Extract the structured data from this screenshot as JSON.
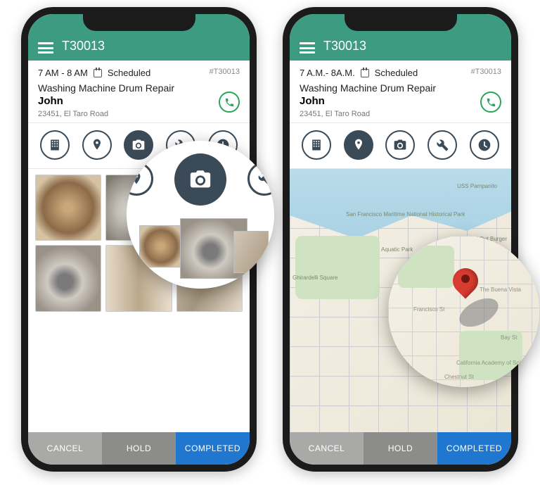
{
  "left": {
    "header": {
      "title": "T30013"
    },
    "ticket": {
      "time": "7 AM - 8 AM",
      "status": "Scheduled",
      "id": "#T30013",
      "title": "Washing Machine Drum Repair",
      "customer": "John",
      "address": "23451, El Taro Road"
    },
    "footer": {
      "cancel": "CANCEL",
      "hold": "HOLD",
      "completed": "COMPLETED"
    }
  },
  "right": {
    "header": {
      "title": "T30013"
    },
    "ticket": {
      "time": "7 A.M.- 8A.M.",
      "status": "Scheduled",
      "id": "#T30013",
      "title": "Washing Machine Drum Repair",
      "customer": "John",
      "address": "23451, El Taro Road"
    },
    "map_labels": {
      "a": "San Francisco Maritime National Historical Park",
      "b": "Ghirardelli Square",
      "c": "Aquatic Park",
      "d": "In-N-Out Burger",
      "e": "USS Pampanito"
    },
    "footer": {
      "cancel": "CANCEL",
      "hold": "HOLD",
      "completed": "COMPLETED"
    }
  },
  "zoom_map_labels": {
    "a": "Francisco St",
    "b": "Bay St",
    "c": "Chestnut St",
    "d": "The Buena Vista",
    "e": "California Academy of Science & Technology"
  }
}
